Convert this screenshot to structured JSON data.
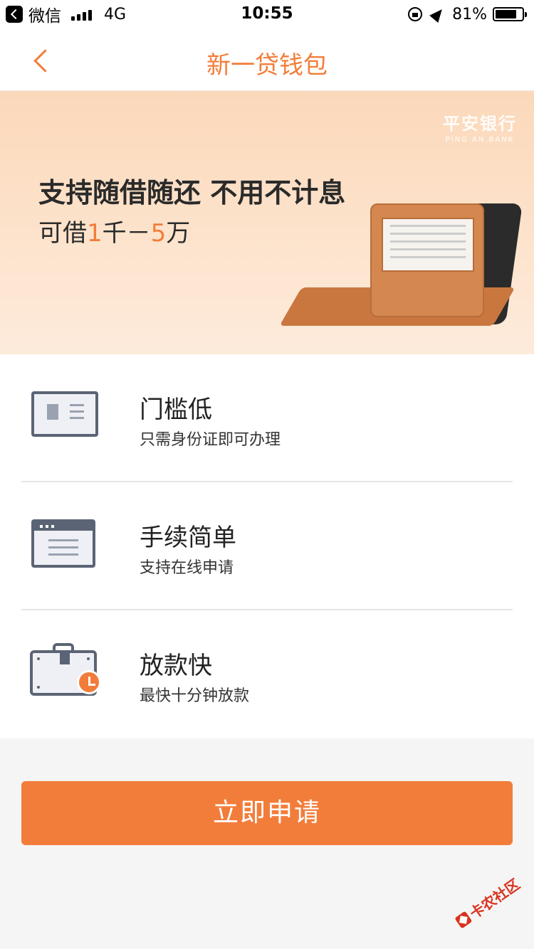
{
  "status_bar": {
    "app_name": "微信",
    "network": "4G",
    "time": "10:55",
    "battery_pct_text": "81%",
    "battery_level": 0.81
  },
  "nav": {
    "title": "新一贷钱包",
    "back_icon": "chevron-left-icon"
  },
  "banner": {
    "bank_cn": "平安银行",
    "bank_en": "PING AN BANK",
    "headline": "支持随借随还 不用不计息",
    "sub_prefix": "可借",
    "sub_min": "1",
    "sub_mid": "千－",
    "sub_max": "5",
    "sub_suffix": "万",
    "image": "wallet-illustration"
  },
  "features": [
    {
      "icon": "id-card-icon",
      "title": "门槛低",
      "desc": "只需身份证即可办理"
    },
    {
      "icon": "browser-window-icon",
      "title": "手续简单",
      "desc": "支持在线申请"
    },
    {
      "icon": "briefcase-clock-icon",
      "title": "放款快",
      "desc": "最快十分钟放款"
    }
  ],
  "apply_button": {
    "label": "立即申请"
  },
  "watermark": {
    "text": "卡农社区"
  },
  "colors": {
    "accent": "#f27d3a",
    "icon_stroke": "#5b6475",
    "banner_bg": "#fbd8ba",
    "page_bg": "#f5f5f5"
  }
}
